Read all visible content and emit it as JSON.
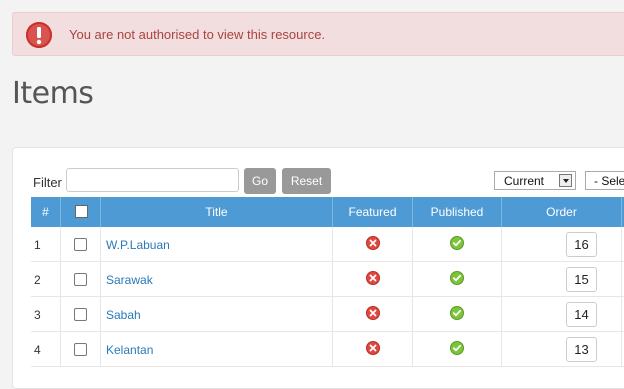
{
  "alert": {
    "message": "You are not authorised to view this resource.",
    "icon": "exclamation-icon",
    "color": "#a94442"
  },
  "page": {
    "title": "Items"
  },
  "filter": {
    "label": "Filter",
    "value": "",
    "go_label": "Go",
    "reset_label": "Reset"
  },
  "selects": {
    "state": "Current",
    "second": "- Sele"
  },
  "table": {
    "headers": {
      "num": "#",
      "title": "Title",
      "featured": "Featured",
      "published": "Published",
      "order": "Order"
    },
    "rows": [
      {
        "num": "1",
        "title": "W.P.Labuan",
        "featured": false,
        "published": true,
        "order": "16"
      },
      {
        "num": "2",
        "title": "Sarawak",
        "featured": false,
        "published": true,
        "order": "15"
      },
      {
        "num": "3",
        "title": "Sabah",
        "featured": false,
        "published": true,
        "order": "14"
      },
      {
        "num": "4",
        "title": "Kelantan",
        "featured": false,
        "published": true,
        "order": "13"
      }
    ]
  },
  "colors": {
    "header": "#4d9ad4",
    "link": "#2a7ab8",
    "alert_bg": "#f2dede"
  }
}
